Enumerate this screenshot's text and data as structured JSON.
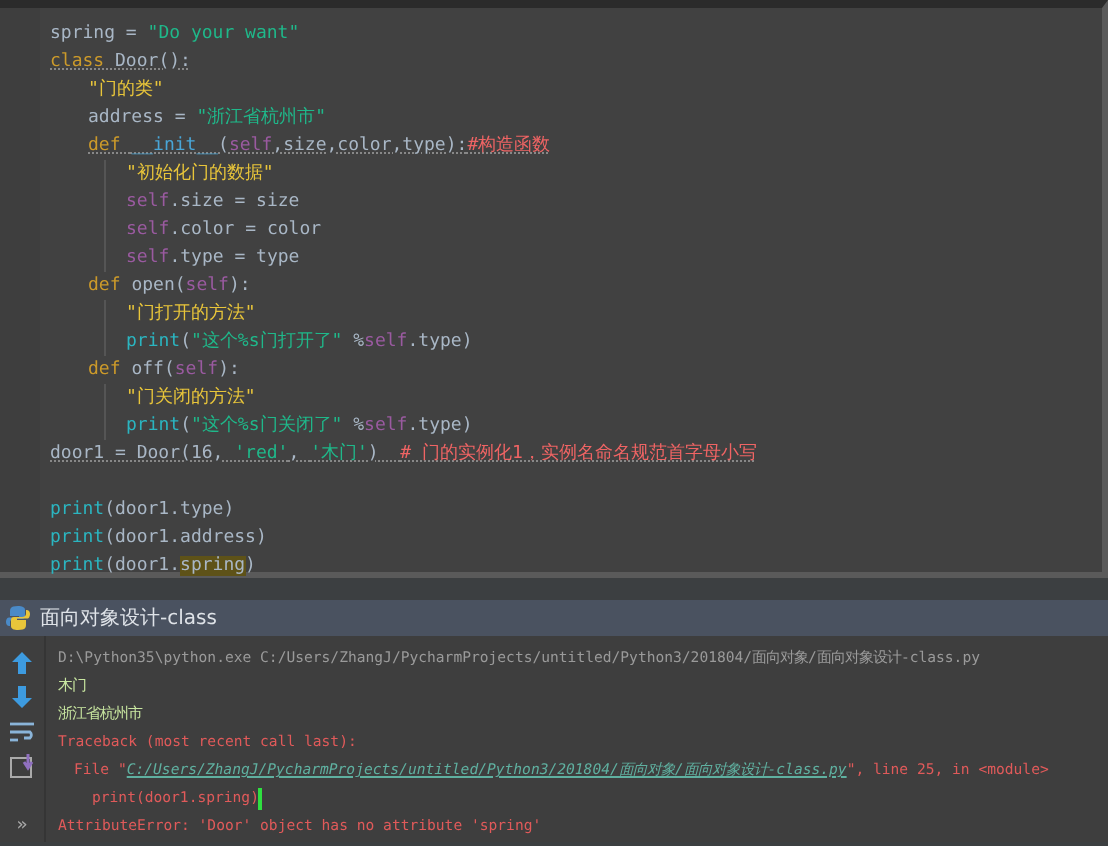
{
  "editor": {
    "lines": [
      {
        "tokens": [
          {
            "kind": "name",
            "text": "spring = "
          },
          {
            "kind": "string",
            "text": "\"Do your want\""
          }
        ]
      },
      {
        "warning": true,
        "tokens": [
          {
            "kind": "keyword",
            "text": "class "
          },
          {
            "kind": "name",
            "text": "Door():"
          }
        ],
        "children": [
          {
            "tokens": [
              {
                "kind": "docstring",
                "text": "\"门的类\""
              }
            ]
          },
          {
            "tokens": [
              {
                "kind": "name",
                "text": "address = "
              },
              {
                "kind": "string",
                "text": "\"浙江省杭州市\""
              }
            ]
          },
          {
            "warning": true,
            "tokens": [
              {
                "kind": "keyword",
                "text": "def "
              },
              {
                "kind": "magic",
                "text": "__init__"
              },
              {
                "kind": "name",
                "text": "("
              },
              {
                "kind": "self",
                "text": "self"
              },
              {
                "kind": "name",
                "text": ",size,color,type):"
              },
              {
                "kind": "comment",
                "text": "#构造函数"
              }
            ],
            "children": [
              {
                "tokens": [
                  {
                    "kind": "docstring",
                    "text": "\"初始化门的数据\""
                  }
                ]
              },
              {
                "tokens": [
                  {
                    "kind": "self",
                    "text": "self"
                  },
                  {
                    "kind": "name",
                    "text": ".size = size"
                  }
                ]
              },
              {
                "tokens": [
                  {
                    "kind": "self",
                    "text": "self"
                  },
                  {
                    "kind": "name",
                    "text": ".color = color"
                  }
                ]
              },
              {
                "tokens": [
                  {
                    "kind": "self",
                    "text": "self"
                  },
                  {
                    "kind": "name",
                    "text": ".type = type"
                  }
                ]
              }
            ]
          },
          {
            "tokens": [
              {
                "kind": "keyword",
                "text": "def "
              },
              {
                "kind": "name",
                "text": "open("
              },
              {
                "kind": "self",
                "text": "self"
              },
              {
                "kind": "name",
                "text": "):"
              }
            ],
            "children": [
              {
                "tokens": [
                  {
                    "kind": "docstring",
                    "text": "\"门打开的方法\""
                  }
                ]
              },
              {
                "tokens": [
                  {
                    "kind": "builtin",
                    "text": "print"
                  },
                  {
                    "kind": "name",
                    "text": "("
                  },
                  {
                    "kind": "string",
                    "text": "\"这个%s门打开了\""
                  },
                  {
                    "kind": "name",
                    "text": " %"
                  },
                  {
                    "kind": "self",
                    "text": "self"
                  },
                  {
                    "kind": "name",
                    "text": ".type)"
                  }
                ]
              }
            ]
          },
          {
            "tokens": [
              {
                "kind": "keyword",
                "text": "def "
              },
              {
                "kind": "name",
                "text": "off("
              },
              {
                "kind": "self",
                "text": "self"
              },
              {
                "kind": "name",
                "text": "):"
              }
            ],
            "children": [
              {
                "tokens": [
                  {
                    "kind": "docstring",
                    "text": "\"门关闭的方法\""
                  }
                ]
              },
              {
                "tokens": [
                  {
                    "kind": "builtin",
                    "text": "print"
                  },
                  {
                    "kind": "name",
                    "text": "("
                  },
                  {
                    "kind": "string",
                    "text": "\"这个%s门关闭了\""
                  },
                  {
                    "kind": "name",
                    "text": " %"
                  },
                  {
                    "kind": "self",
                    "text": "self"
                  },
                  {
                    "kind": "name",
                    "text": ".type)"
                  }
                ]
              }
            ]
          }
        ]
      },
      {
        "warning": true,
        "tokens": [
          {
            "kind": "name",
            "text": "door1 = Door(16, "
          },
          {
            "kind": "string",
            "text": "'red'"
          },
          {
            "kind": "name",
            "text": ", "
          },
          {
            "kind": "string",
            "text": "'木门'"
          },
          {
            "kind": "name",
            "text": ")  "
          },
          {
            "kind": "comment",
            "text": "# 门的实例化1，实例名命名规范首字母小写"
          }
        ]
      },
      {
        "tokens": [
          {
            "kind": "builtin",
            "text": "print"
          },
          {
            "kind": "name",
            "text": "(door1.type)"
          }
        ]
      },
      {
        "tokens": [
          {
            "kind": "builtin",
            "text": "print"
          },
          {
            "kind": "name",
            "text": "(door1.address)"
          }
        ]
      },
      {
        "tokens": [
          {
            "kind": "builtin",
            "text": "print"
          },
          {
            "kind": "name",
            "text": "(door1."
          },
          {
            "kind": "highlight",
            "text": "spring"
          },
          {
            "kind": "name",
            "text": ")"
          }
        ]
      }
    ]
  },
  "run_panel": {
    "title": "面向对象设计-class",
    "more_label": "»",
    "lines": [
      {
        "kind": "command",
        "tokens": [
          {
            "text": "D:\\Python35\\python.exe C:/Users/ZhangJ/PycharmProjects/untitled/Python3/201804/面向对象/面向对象设计-class.py"
          }
        ]
      },
      {
        "kind": "output",
        "tokens": [
          {
            "text": "木门"
          }
        ]
      },
      {
        "kind": "output",
        "tokens": [
          {
            "text": "浙江省杭州市"
          }
        ]
      },
      {
        "kind": "error",
        "tokens": [
          {
            "text": "Traceback (most recent call last):"
          }
        ],
        "children": [
          {
            "kind": "error",
            "tokens": [
              {
                "text": "File \""
              },
              {
                "kind": "link",
                "text": "C:/Users/ZhangJ/PycharmProjects/untitled/Python3/201804/面向对象/面向对象设计-class.py"
              },
              {
                "text": "\", line 25, in <module>"
              }
            ],
            "children": [
              {
                "kind": "error",
                "cursor": true,
                "tokens": [
                  {
                    "text": "print(door1.spring)"
                  }
                ]
              }
            ]
          }
        ]
      },
      {
        "kind": "error",
        "tokens": [
          {
            "text": "AttributeError: 'Door' object has no attribute 'spring'"
          }
        ]
      }
    ]
  }
}
